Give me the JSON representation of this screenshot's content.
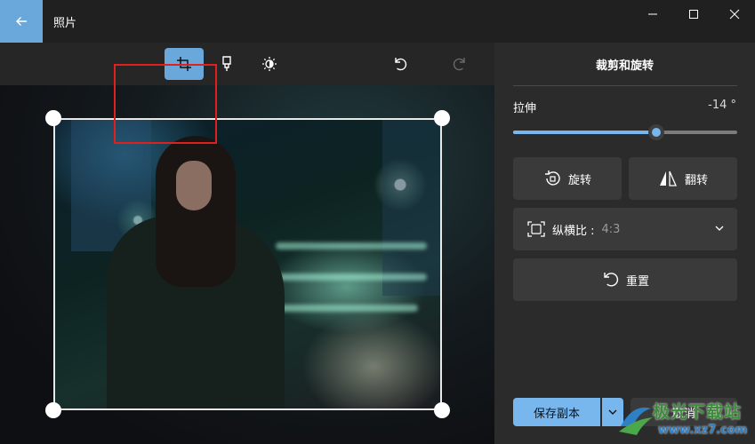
{
  "app": {
    "title": "照片"
  },
  "toolbar": {
    "tools": [
      {
        "icon": "crop-icon",
        "active": true
      },
      {
        "icon": "filter-brush-icon",
        "active": false
      },
      {
        "icon": "brightness-adjust-icon",
        "active": false
      },
      {
        "icon": "undo-icon",
        "enabled": true
      },
      {
        "icon": "redo-icon",
        "enabled": false
      }
    ],
    "highlight_color": "#e01f1f"
  },
  "panel": {
    "title": "裁剪和旋转",
    "straighten": {
      "label": "拉伸",
      "value_text": "-14 °",
      "level": 0.64
    },
    "rotate_label": "旋转",
    "flip_label": "翻转",
    "aspect": {
      "label": "纵横比 :",
      "value": "4:3"
    },
    "reset_label": "重置",
    "save_copy_label": "保存副本",
    "cancel_label": "取消"
  },
  "watermark": {
    "title": "极光下载站",
    "url": "www.xz7.com"
  },
  "colors": {
    "accent": "#78b7ee",
    "back_button": "#6aa7db"
  }
}
